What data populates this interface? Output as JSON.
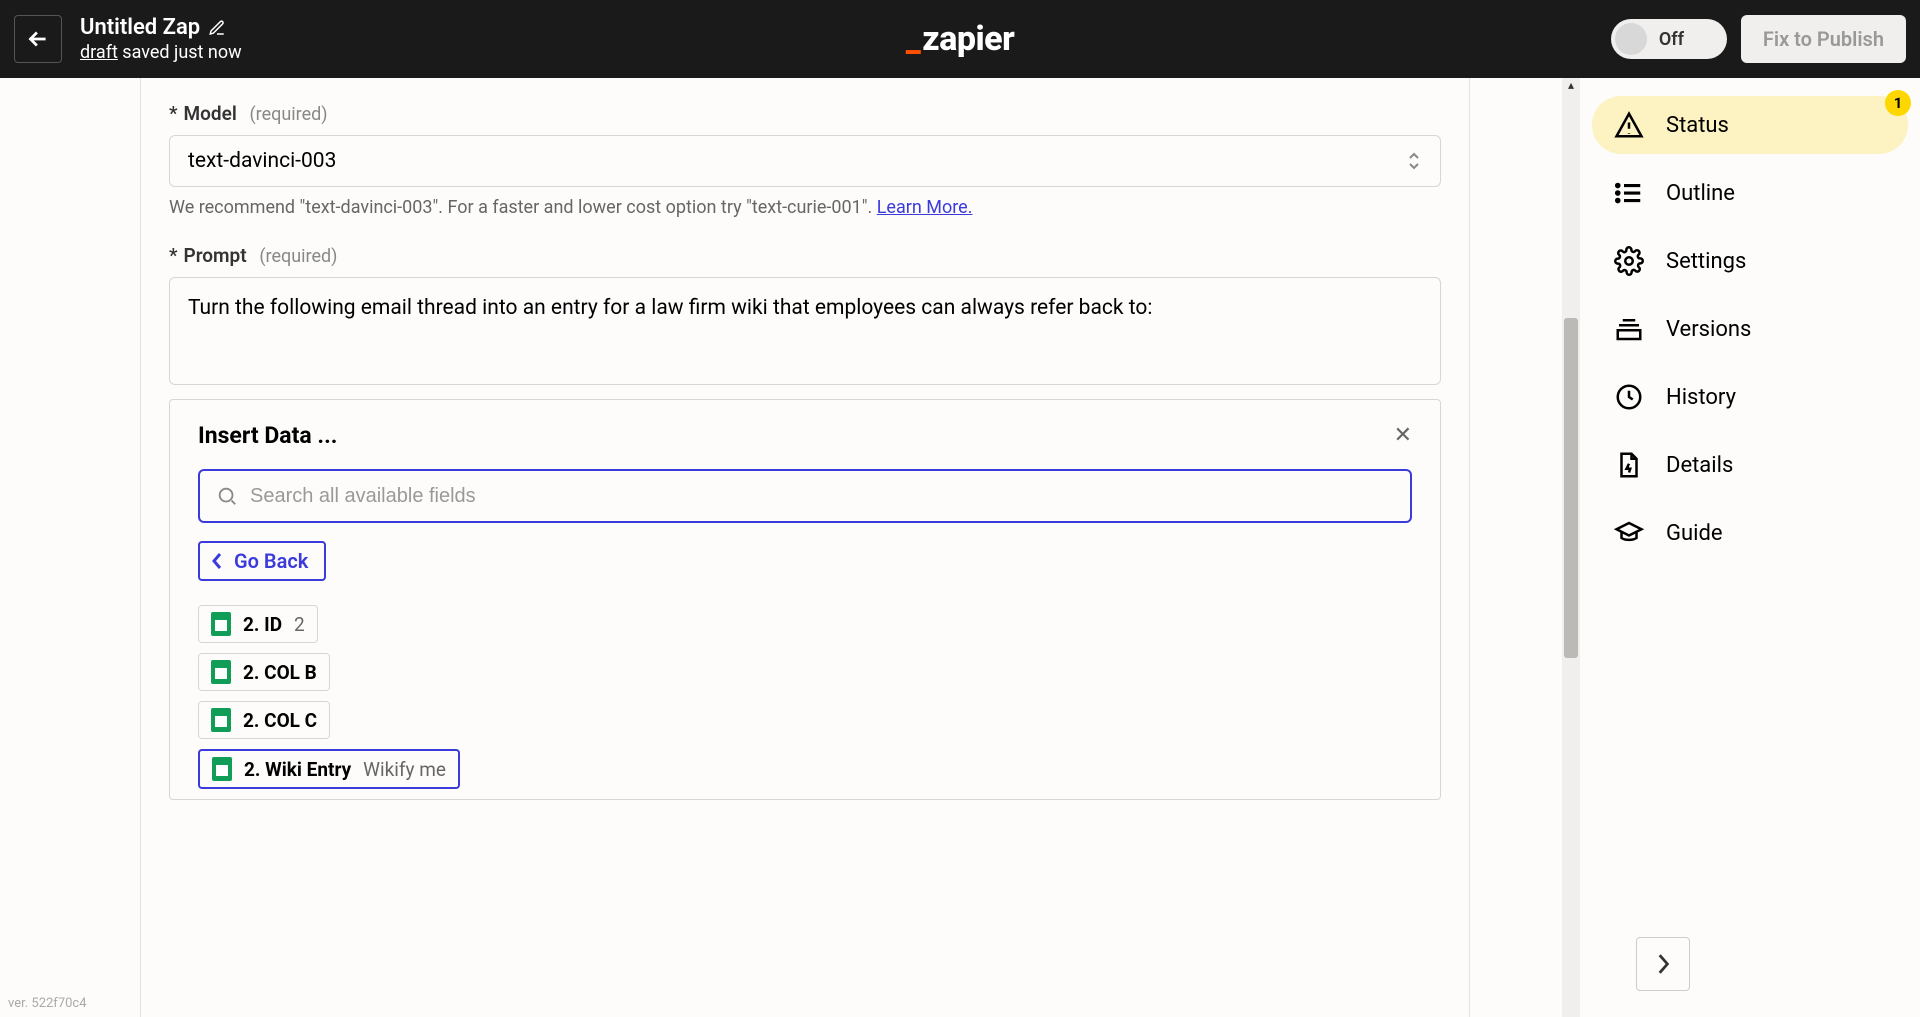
{
  "header": {
    "title": "Untitled Zap",
    "draft_label": "draft",
    "saved_text": " saved just now",
    "toggle_label": "Off",
    "publish_label": "Fix to Publish",
    "logo_text": "zapier"
  },
  "model_field": {
    "label": "Model",
    "required": "(required)",
    "value": "text-davinci-003",
    "help_prefix": "We recommend \"text-davinci-003\". For a faster and lower cost option try \"text-curie-001\". ",
    "help_link": "Learn More."
  },
  "prompt_field": {
    "label": "Prompt",
    "required": "(required)",
    "value": "Turn the following email thread into an entry for a law firm wiki that employees can always refer back to:"
  },
  "insert_panel": {
    "title": "Insert Data ...",
    "search_placeholder": "Search all available fields",
    "go_back": "Go Back",
    "fields": [
      {
        "label": "2. ID",
        "value": "2",
        "selected": false
      },
      {
        "label": "2. COL B",
        "value": "",
        "selected": false
      },
      {
        "label": "2. COL C",
        "value": "",
        "selected": false
      },
      {
        "label": "2. Wiki Entry",
        "value": "Wikify me",
        "selected": true
      }
    ]
  },
  "sidenav": {
    "badge": "1",
    "items": [
      {
        "label": "Status",
        "icon": "warning",
        "active": true
      },
      {
        "label": "Outline",
        "icon": "list",
        "active": false
      },
      {
        "label": "Settings",
        "icon": "gear",
        "active": false
      },
      {
        "label": "Versions",
        "icon": "stack",
        "active": false
      },
      {
        "label": "History",
        "icon": "clock",
        "active": false
      },
      {
        "label": "Details",
        "icon": "bolt-doc",
        "active": false
      },
      {
        "label": "Guide",
        "icon": "grad-cap",
        "active": false
      }
    ]
  },
  "version": "ver. 522f70c4"
}
